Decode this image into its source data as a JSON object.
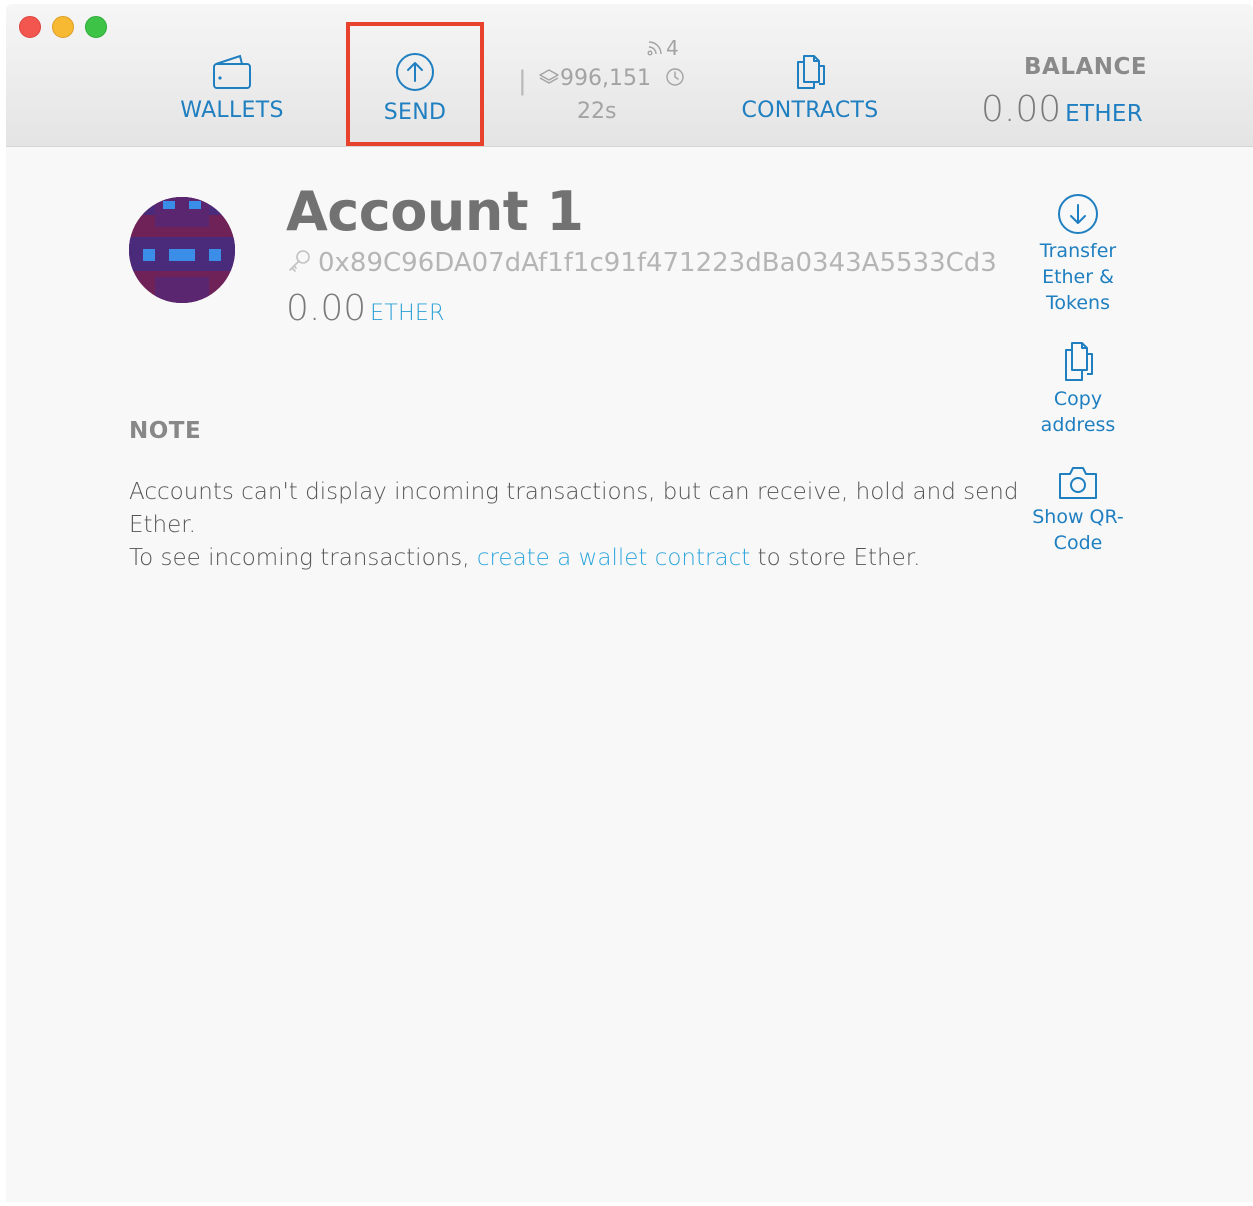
{
  "window": {
    "controls": [
      "close",
      "minimize",
      "zoom"
    ]
  },
  "toolbar": {
    "wallets_label": "WALLETS",
    "send_label": "SEND",
    "contracts_label": "CONTRACTS",
    "peers": "4",
    "separator": "|",
    "block_number": "996,151",
    "last_block_time": "22s",
    "balance_label": "BALANCE",
    "balance_value": "0.00",
    "balance_unit": "ETHER"
  },
  "account": {
    "name": "Account 1",
    "address": "0x89C96DA07dAf1f1c91f471223dBa0343A5533Cd3",
    "balance_value": "0.00",
    "balance_unit": "ETHER"
  },
  "note": {
    "heading": "NOTE",
    "line1": "Accounts can't display incoming transactions, but can receive, hold and send Ether.",
    "line2_prefix": "To see incoming transactions, ",
    "line2_link": "create a wallet contract",
    "line2_suffix": " to store Ether."
  },
  "actions": {
    "transfer_line1": "Transfer",
    "transfer_line2": "Ether &",
    "transfer_line3": "Tokens",
    "copy_line1": "Copy",
    "copy_line2": "address",
    "qr_line1": "Show QR-",
    "qr_line2": "Code"
  },
  "icons": {
    "wallets": "wallet-icon",
    "send": "arrow-up-circle-icon",
    "contracts": "documents-icon",
    "peers": "signal-icon",
    "block": "layers-icon",
    "clock": "clock-icon",
    "key": "key-icon",
    "transfer": "arrow-down-circle-icon",
    "copy": "documents-icon",
    "qr": "camera-icon"
  },
  "colors": {
    "accent": "#1f7fc0",
    "link": "#2ea5dc",
    "highlight_box": "#e8412c",
    "traffic_red": "#f2564e",
    "traffic_yellow": "#f8b932",
    "traffic_green": "#3dc446"
  }
}
